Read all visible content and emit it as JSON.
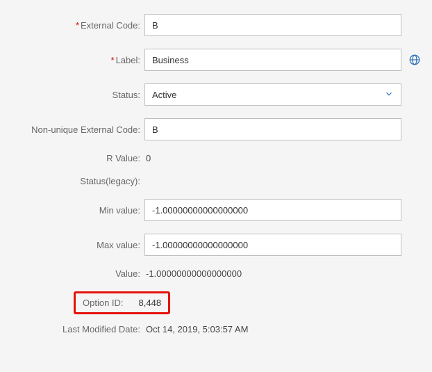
{
  "labels": {
    "external_code": "External Code:",
    "label": "Label:",
    "status": "Status:",
    "non_unique_external_code": "Non-unique External Code:",
    "r_value": "R Value:",
    "status_legacy": "Status(legacy):",
    "min_value": "Min value:",
    "max_value": "Max value:",
    "value": "Value:",
    "option_id": "Option ID:",
    "last_modified": "Last Modified Date:"
  },
  "values": {
    "external_code": "B",
    "label": "Business",
    "status": "Active",
    "non_unique_external_code": "B",
    "r_value": "0",
    "status_legacy": "",
    "min_value": "-1.00000000000000000",
    "max_value": "-1.00000000000000000",
    "value": "-1.00000000000000000",
    "option_id": "8,448",
    "last_modified": "Oct 14, 2019, 5:03:57 AM"
  },
  "required_marker": "*"
}
